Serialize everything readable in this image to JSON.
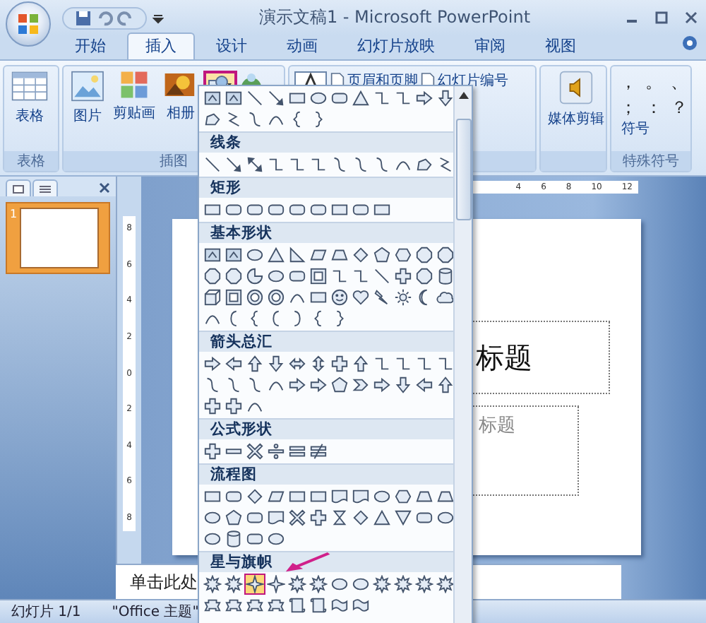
{
  "window": {
    "title": "演示文稿1 - Microsoft PowerPoint"
  },
  "tabs": [
    {
      "label": "开始",
      "selected": false
    },
    {
      "label": "插入",
      "selected": true
    },
    {
      "label": "设计",
      "selected": false
    },
    {
      "label": "动画",
      "selected": false
    },
    {
      "label": "幻灯片放映",
      "selected": false
    },
    {
      "label": "审阅",
      "selected": false
    },
    {
      "label": "视图",
      "selected": false
    }
  ],
  "ribbon": {
    "groups": [
      {
        "label": "表格",
        "items": [
          {
            "kind": "table",
            "label": "表格"
          }
        ]
      },
      {
        "label": "插图",
        "items": [
          {
            "kind": "picture",
            "label": "图片"
          },
          {
            "kind": "clipart",
            "label": "剪贴画"
          },
          {
            "kind": "album",
            "label": "相册"
          },
          {
            "kind": "shapes",
            "expanded": true
          },
          {
            "kind": "smartart"
          }
        ]
      },
      {
        "items": [
          {
            "kind": "textbox"
          },
          {
            "kind": "small",
            "label": "页眉和页脚"
          },
          {
            "kind": "small",
            "label": "幻灯片编号"
          }
        ]
      },
      {
        "items": [
          {
            "kind": "media",
            "label": "媒体剪辑"
          }
        ]
      },
      {
        "label": "特殊符号",
        "items": [
          {
            "kind": "symbols",
            "marks": [
              "，",
              "。",
              "、",
              "；",
              "：",
              "？"
            ],
            "label": "符号"
          }
        ]
      }
    ]
  },
  "shape_gallery": {
    "sections": [
      {
        "shapes": [
          {
            "kind": "text-box",
            "selected": false
          },
          {
            "kind": "text-box",
            "selected": false
          },
          {
            "kind": "line",
            "selected": false
          },
          {
            "kind": "arrow",
            "selected": false
          },
          {
            "kind": "rectangle",
            "selected": false
          },
          {
            "kind": "oval",
            "selected": false
          },
          {
            "kind": "rounded-rectangle",
            "selected": false
          },
          {
            "kind": "triangle",
            "selected": false
          },
          {
            "kind": "elbow",
            "selected": false
          },
          {
            "kind": "elbow",
            "selected": false
          },
          {
            "kind": "right-arrow",
            "selected": false
          },
          {
            "kind": "down-arrow",
            "selected": false
          },
          {
            "kind": "freeform",
            "selected": false
          },
          {
            "kind": "scribble",
            "selected": false
          },
          {
            "kind": "curve",
            "selected": false
          },
          {
            "kind": "arc",
            "selected": false
          },
          {
            "kind": "left-brace",
            "selected": false
          },
          {
            "kind": "right-brace",
            "selected": false
          }
        ]
      },
      {
        "title": "线条",
        "shapes": [
          {
            "kind": "line",
            "selected": false
          },
          {
            "kind": "arrow",
            "selected": false
          },
          {
            "kind": "double-arrow",
            "selected": false
          },
          {
            "kind": "elbow",
            "selected": false
          },
          {
            "kind": "elbow",
            "selected": false
          },
          {
            "kind": "elbow",
            "selected": false
          },
          {
            "kind": "curve",
            "selected": false
          },
          {
            "kind": "curve",
            "selected": false
          },
          {
            "kind": "curve",
            "selected": false
          },
          {
            "kind": "arc",
            "selected": false
          },
          {
            "kind": "freeform",
            "selected": false
          },
          {
            "kind": "scribble",
            "selected": false
          }
        ]
      },
      {
        "title": "矩形",
        "shapes": [
          {
            "kind": "rectangle",
            "selected": false
          },
          {
            "kind": "rounded-rectangle",
            "selected": false
          },
          {
            "kind": "rounded-rectangle",
            "selected": false
          },
          {
            "kind": "rounded-rectangle",
            "selected": false
          },
          {
            "kind": "rounded-rectangle",
            "selected": false
          },
          {
            "kind": "rounded-rectangle",
            "selected": false
          },
          {
            "kind": "rectangle",
            "selected": false
          },
          {
            "kind": "rounded-rectangle",
            "selected": false
          },
          {
            "kind": "rectangle",
            "selected": false
          }
        ]
      },
      {
        "title": "基本形状",
        "shapes": [
          {
            "kind": "text-box",
            "selected": false
          },
          {
            "kind": "text-box",
            "selected": false
          },
          {
            "kind": "oval",
            "selected": false
          },
          {
            "kind": "triangle",
            "selected": false
          },
          {
            "kind": "right-triangle",
            "selected": false
          },
          {
            "kind": "parallelogram",
            "selected": false
          },
          {
            "kind": "trapezoid",
            "selected": false
          },
          {
            "kind": "diamond",
            "selected": false
          },
          {
            "kind": "pentagon",
            "selected": false
          },
          {
            "kind": "hexagon",
            "selected": false
          },
          {
            "kind": "octagon",
            "selected": false
          },
          {
            "kind": "octagon",
            "selected": false
          },
          {
            "kind": "octagon",
            "selected": false
          },
          {
            "kind": "octagon",
            "selected": false
          },
          {
            "kind": "pie",
            "selected": false
          },
          {
            "kind": "oval",
            "selected": false
          },
          {
            "kind": "rounded-rectangle",
            "selected": false
          },
          {
            "kind": "frame",
            "selected": false
          },
          {
            "kind": "elbow",
            "selected": false
          },
          {
            "kind": "elbow",
            "selected": false
          },
          {
            "kind": "line",
            "selected": false
          },
          {
            "kind": "plus",
            "selected": false
          },
          {
            "kind": "octagon",
            "selected": false
          },
          {
            "kind": "can",
            "selected": false
          },
          {
            "kind": "cube",
            "selected": false
          },
          {
            "kind": "frame",
            "selected": false
          },
          {
            "kind": "ring",
            "selected": false
          },
          {
            "kind": "ring",
            "selected": false
          },
          {
            "kind": "arc",
            "selected": false
          },
          {
            "kind": "rectangle",
            "selected": false
          },
          {
            "kind": "smiley",
            "selected": false
          },
          {
            "kind": "heart",
            "selected": false
          },
          {
            "kind": "lightning",
            "selected": false
          },
          {
            "kind": "sun",
            "selected": false
          },
          {
            "kind": "moon",
            "selected": false
          },
          {
            "kind": "cloud",
            "selected": false
          },
          {
            "kind": "arc",
            "selected": false
          },
          {
            "kind": "left-bracket",
            "selected": false
          },
          {
            "kind": "left-brace",
            "selected": false
          },
          {
            "kind": "left-bracket",
            "selected": false
          },
          {
            "kind": "right-bracket",
            "selected": false
          },
          {
            "kind": "left-brace",
            "selected": false
          },
          {
            "kind": "right-brace",
            "selected": false
          }
        ]
      },
      {
        "title": "箭头总汇",
        "shapes": [
          {
            "kind": "right-arrow",
            "selected": false
          },
          {
            "kind": "left-arrow",
            "selected": false
          },
          {
            "kind": "up-arrow",
            "selected": false
          },
          {
            "kind": "down-arrow",
            "selected": false
          },
          {
            "kind": "left-right-arrow",
            "selected": false
          },
          {
            "kind": "up-down-arrow",
            "selected": false
          },
          {
            "kind": "plus",
            "selected": false
          },
          {
            "kind": "up-arrow",
            "selected": false
          },
          {
            "kind": "elbow",
            "selected": false
          },
          {
            "kind": "elbow",
            "selected": false
          },
          {
            "kind": "elbow",
            "selected": false
          },
          {
            "kind": "elbow",
            "selected": false
          },
          {
            "kind": "curve",
            "selected": false
          },
          {
            "kind": "curve",
            "selected": false
          },
          {
            "kind": "curve",
            "selected": false
          },
          {
            "kind": "arc",
            "selected": false
          },
          {
            "kind": "right-arrow",
            "selected": false
          },
          {
            "kind": "right-arrow",
            "selected": false
          },
          {
            "kind": "pentagon",
            "selected": false
          },
          {
            "kind": "chevron",
            "selected": false
          },
          {
            "kind": "right-arrow",
            "selected": false
          },
          {
            "kind": "down-arrow",
            "selected": false
          },
          {
            "kind": "left-arrow",
            "selected": false
          },
          {
            "kind": "up-arrow",
            "selected": false
          },
          {
            "kind": "plus",
            "selected": false
          },
          {
            "kind": "plus",
            "selected": false
          },
          {
            "kind": "arc",
            "selected": false
          }
        ]
      },
      {
        "title": "公式形状",
        "shapes": [
          {
            "kind": "plus",
            "selected": false
          },
          {
            "kind": "minus",
            "selected": false
          },
          {
            "kind": "multiply",
            "selected": false
          },
          {
            "kind": "divide",
            "selected": false
          },
          {
            "kind": "equal",
            "selected": false
          },
          {
            "kind": "not-equal",
            "selected": false
          }
        ]
      },
      {
        "title": "流程图",
        "shapes": [
          {
            "kind": "rectangle",
            "selected": false
          },
          {
            "kind": "rounded-rectangle",
            "selected": false
          },
          {
            "kind": "diamond",
            "selected": false
          },
          {
            "kind": "parallelogram",
            "selected": false
          },
          {
            "kind": "rectangle",
            "selected": false
          },
          {
            "kind": "rectangle",
            "selected": false
          },
          {
            "kind": "document",
            "selected": false
          },
          {
            "kind": "document",
            "selected": false
          },
          {
            "kind": "oval",
            "selected": false
          },
          {
            "kind": "hexagon",
            "selected": false
          },
          {
            "kind": "trapezoid",
            "selected": false
          },
          {
            "kind": "trapezoid",
            "selected": false
          },
          {
            "kind": "oval",
            "selected": false
          },
          {
            "kind": "pentagon",
            "selected": false
          },
          {
            "kind": "rounded-rectangle",
            "selected": false
          },
          {
            "kind": "document",
            "selected": false
          },
          {
            "kind": "multiply",
            "selected": false
          },
          {
            "kind": "plus",
            "selected": false
          },
          {
            "kind": "hourglass",
            "selected": false
          },
          {
            "kind": "diamond",
            "selected": false
          },
          {
            "kind": "triangle",
            "selected": false
          },
          {
            "kind": "down-triangle",
            "selected": false
          },
          {
            "kind": "rounded-rectangle",
            "selected": false
          },
          {
            "kind": "oval",
            "selected": false
          },
          {
            "kind": "oval",
            "selected": false
          },
          {
            "kind": "can",
            "selected": false
          },
          {
            "kind": "rounded-rectangle",
            "selected": false
          },
          {
            "kind": "oval",
            "selected": false
          }
        ]
      },
      {
        "title": "星与旗帜",
        "shapes": [
          {
            "kind": "burst",
            "selected": false
          },
          {
            "kind": "burst",
            "selected": false
          },
          {
            "kind": "star",
            "selected": true
          },
          {
            "kind": "star",
            "selected": false
          },
          {
            "kind": "burst",
            "selected": false
          },
          {
            "kind": "burst",
            "selected": false
          },
          {
            "kind": "oval",
            "selected": false
          },
          {
            "kind": "oval",
            "selected": false
          },
          {
            "kind": "burst",
            "selected": false
          },
          {
            "kind": "burst",
            "selected": false
          },
          {
            "kind": "burst",
            "selected": false
          },
          {
            "kind": "burst",
            "selected": false
          },
          {
            "kind": "ribbon",
            "selected": false
          },
          {
            "kind": "ribbon",
            "selected": false
          },
          {
            "kind": "ribbon",
            "selected": false
          },
          {
            "kind": "ribbon",
            "selected": false
          },
          {
            "kind": "scroll",
            "selected": false
          },
          {
            "kind": "scroll",
            "selected": false
          },
          {
            "kind": "wave",
            "selected": false
          },
          {
            "kind": "wave",
            "selected": false
          }
        ]
      }
    ]
  },
  "rulers": {
    "horizontal": [
      "4",
      "6",
      "8",
      "10",
      "12"
    ],
    "vertical": [
      "8",
      "6",
      "4",
      "2",
      "0",
      "2",
      "4",
      "6",
      "8"
    ]
  },
  "slides": [
    {
      "number": "1",
      "selected": true
    }
  ],
  "slide": {
    "title": "标题",
    "subtitle": "标题"
  },
  "notes": {
    "placeholder": "单击此处"
  },
  "status_bar": [
    "幻灯片 1/1",
    "\"Office 主题\""
  ]
}
